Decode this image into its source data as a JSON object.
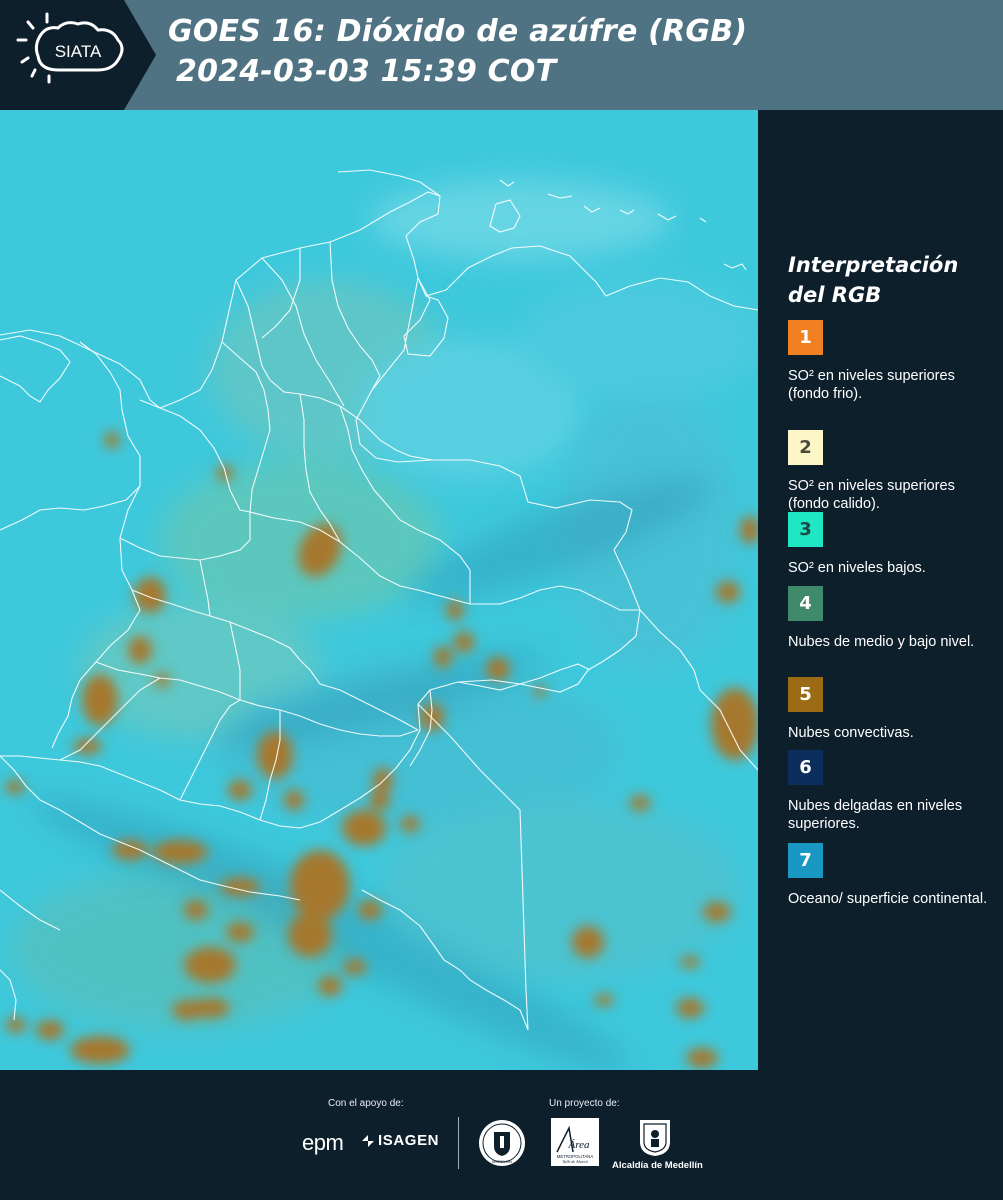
{
  "header": {
    "logo_text": "SIATA",
    "title": "GOES 16: Dióxido de azúfre (RGB)",
    "datetime": "2024-03-03 15:39 COT"
  },
  "legend": {
    "title_line1": "Interpretación",
    "title_line2": "del RGB",
    "items": [
      {
        "number": "1",
        "color": "#f08021",
        "number_color": "#ffffff",
        "text": "SO² en niveles superiores (fondo frio)."
      },
      {
        "number": "2",
        "color": "#fdf6c6",
        "number_color": "#4a4a3a",
        "text": "SO² en niveles superiores (fondo calido)."
      },
      {
        "number": "3",
        "color": "#1fe6c3",
        "number_color": "#1d4a44",
        "text": "SO² en niveles bajos."
      },
      {
        "number": "4",
        "color": "#3f8a6a",
        "number_color": "#ffffff",
        "text": "Nubes de medio y bajo nivel."
      },
      {
        "number": "5",
        "color": "#9a6a14",
        "number_color": "#ffffff",
        "text": "Nubes convectivas."
      },
      {
        "number": "6",
        "color": "#0c2e5c",
        "number_color": "#ffffff",
        "text": "Nubes delgadas en niveles superiores."
      },
      {
        "number": "7",
        "color": "#1a97c3",
        "number_color": "#ffffff",
        "text": "Oceano/ superficie continental."
      }
    ]
  },
  "footer": {
    "support_label": "Con el apoyo de:",
    "project_label": "Un proyecto de:",
    "sponsor_epm": "epm",
    "sponsor_isagen": "ISAGEN",
    "seal_text": "MEDELLÍN",
    "area_logo_text": "Área",
    "area_line1": "METROPOLITANA",
    "area_line2": "Valle de Aburrá",
    "alcaldia_text": "Alcaldía de Medellín"
  },
  "map": {
    "ocean_color": "#3ec8dc",
    "land_color": "#5cd2df",
    "convective_color": "#a6782e",
    "border_color": "#ffffff"
  }
}
